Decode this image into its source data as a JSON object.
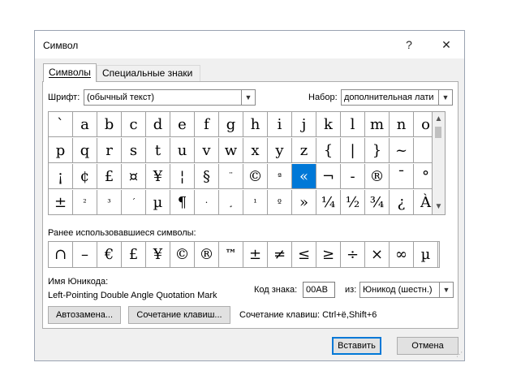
{
  "window": {
    "title": "Символ",
    "help": "?",
    "close": "✕"
  },
  "tabs": [
    {
      "label": "Символы"
    },
    {
      "label": "Специальные знаки"
    }
  ],
  "font": {
    "label": "Шрифт:",
    "value": "(обычный текст)"
  },
  "subset": {
    "label": "Набор:",
    "value": "дополнительная лати"
  },
  "grid_rows": [
    [
      "`",
      "a",
      "b",
      "c",
      "d",
      "e",
      "f",
      "g",
      "h",
      "i",
      "j",
      "k",
      "l",
      "m",
      "n",
      "o"
    ],
    [
      "p",
      "q",
      "r",
      "s",
      "t",
      "u",
      "v",
      "w",
      "x",
      "y",
      "z",
      "{",
      "|",
      "}",
      "~",
      ""
    ],
    [
      "¡",
      "¢",
      "£",
      "¤",
      "¥",
      "¦",
      "§",
      "¨",
      "©",
      "ª",
      "«",
      "¬",
      "-",
      "®",
      "¯",
      "°"
    ],
    [
      "±",
      "²",
      "³",
      "´",
      "µ",
      "¶",
      "·",
      "¸",
      "¹",
      "º",
      "»",
      "¼",
      "½",
      "¾",
      "¿",
      "À"
    ]
  ],
  "selected_symbol": "«",
  "recent": {
    "label": "Ранее использовавшиеся символы:",
    "symbols": [
      "∩",
      "–",
      "€",
      "£",
      "¥",
      "©",
      "®",
      "™",
      "±",
      "≠",
      "≤",
      "≥",
      "÷",
      "×",
      "∞",
      "µ"
    ]
  },
  "unicode": {
    "name_label": "Имя Юникода:",
    "name_value": "Left-Pointing Double Angle Quotation Mark",
    "code_label": "Код знака:",
    "code_value": "00AB",
    "from_label": "из:",
    "from_value": "Юникод (шестн.)"
  },
  "buttons": {
    "autocorrect": "Автозамена...",
    "shortcut_key": "Сочетание клавиш...",
    "shortcut_text": "Сочетание клавиш: Ctrl+ё,Shift+6",
    "insert": "Вставить",
    "cancel": "Отмена"
  }
}
